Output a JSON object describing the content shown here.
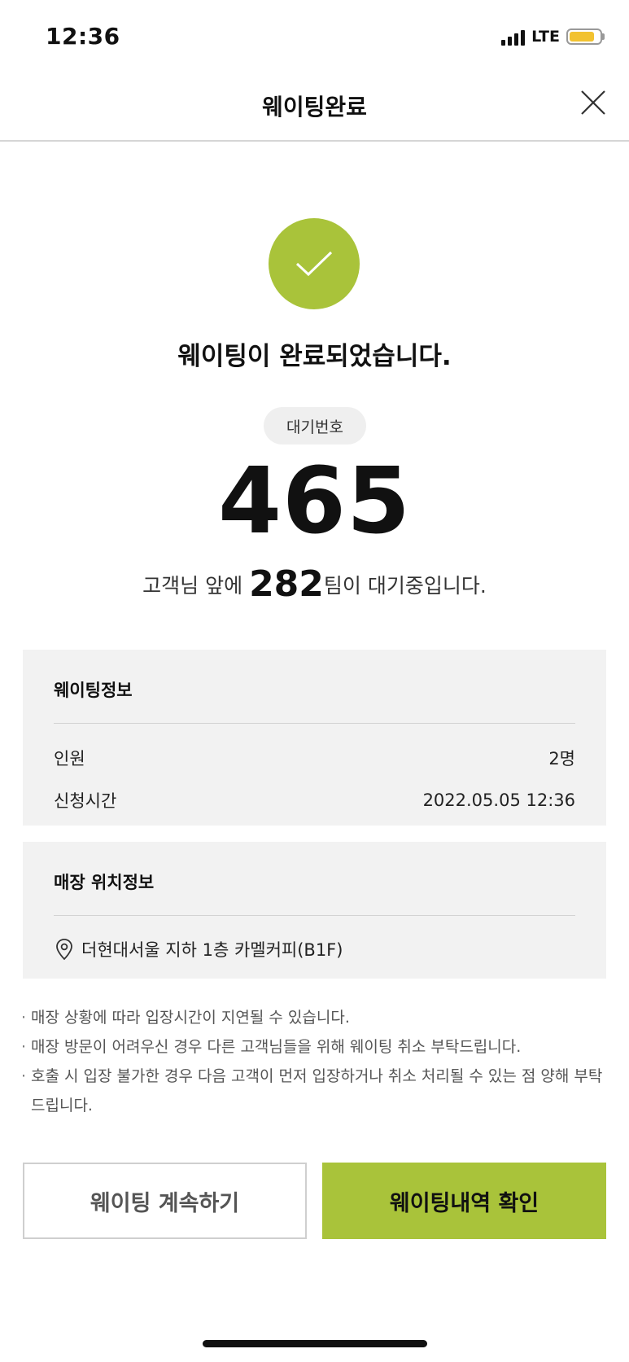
{
  "status_bar": {
    "time": "12:36",
    "network": "LTE"
  },
  "header": {
    "title": "웨이팅완료"
  },
  "success": {
    "message": "웨이팅이 완료되었습니다.",
    "wait_label": "대기번호",
    "wait_number": "465",
    "queue_prefix": "고객님 앞에 ",
    "queue_count": "282",
    "queue_suffix": "팀이 대기중입니다."
  },
  "waiting_info": {
    "title": "웨이팅정보",
    "rows": [
      {
        "label": "인원",
        "value": "2명"
      },
      {
        "label": "신청시간",
        "value": "2022.05.05 12:36"
      }
    ]
  },
  "store_location": {
    "title": "매장 위치정보",
    "address": "더현대서울 지하 1층 카멜커피(B1F)"
  },
  "notes": [
    "매장 상황에 따라 입장시간이 지연될 수 있습니다.",
    "매장 방문이 어려우신 경우 다른 고객님들을 위해 웨이팅 취소 부탁드립니다.",
    "호출 시 입장 불가한 경우 다음 고객이 먼저 입장하거나 취소 처리될 수 있는 점 양해 부탁드립니다."
  ],
  "buttons": {
    "continue_label": "웨이팅 계속하기",
    "history_label": "웨이팅내역 확인"
  },
  "colors": {
    "accent": "#a9c33a",
    "card_bg": "#f2f2f2",
    "battery": "#f2c230"
  },
  "icons": [
    "check-icon",
    "close-icon",
    "location-pin-icon",
    "signal-icon",
    "battery-icon"
  ]
}
